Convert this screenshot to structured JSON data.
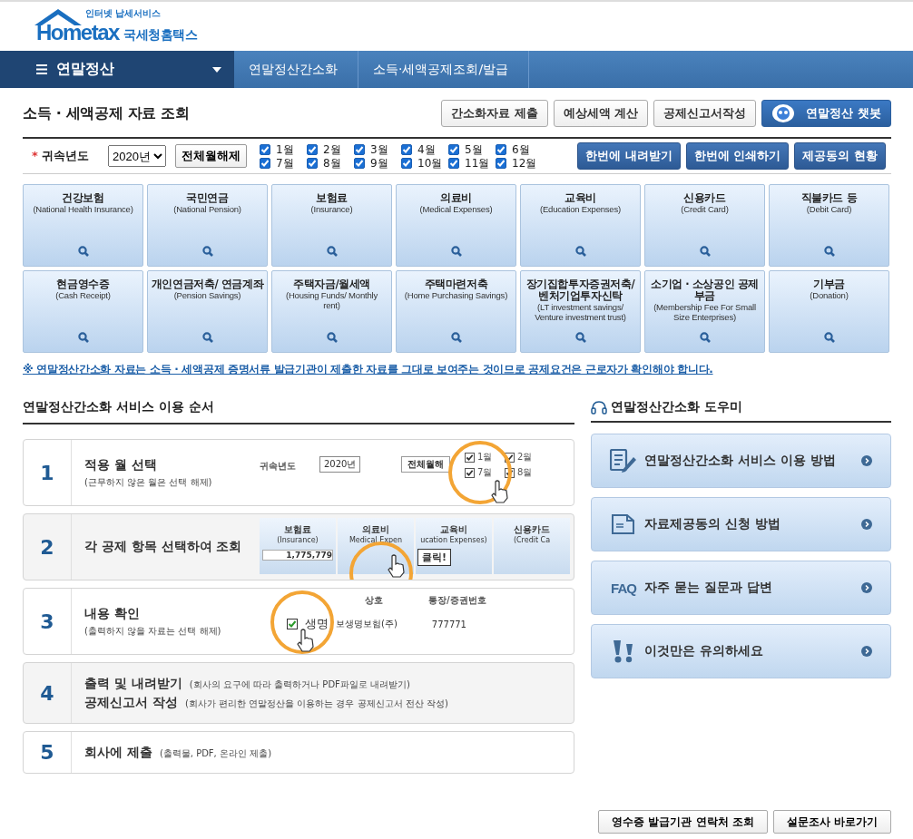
{
  "logo": {
    "tagline": "인터넷 납세서비스",
    "brand": "Hometax",
    "name": "국세청홈택스"
  },
  "nav": {
    "menu": "연말정산",
    "crumbs": [
      "연말정산간소화",
      "소득·세액공제조회/발급"
    ]
  },
  "page_title": "소득 · 세액공제 자료 조회",
  "top_buttons": [
    {
      "label": "간소화자료 제출",
      "kind": "plain"
    },
    {
      "label": "예상세액 계산",
      "kind": "plain"
    },
    {
      "label": "공제신고서작성",
      "kind": "plain"
    },
    {
      "label": "연말정산 챗봇",
      "kind": "chatbot"
    }
  ],
  "filter": {
    "required_mark": "*",
    "label": "귀속년도",
    "year": "2020년",
    "clear_button": "전체월해제",
    "months": [
      {
        "label": "1월",
        "checked": true
      },
      {
        "label": "2월",
        "checked": true
      },
      {
        "label": "3월",
        "checked": true
      },
      {
        "label": "4월",
        "checked": true
      },
      {
        "label": "5월",
        "checked": true
      },
      {
        "label": "6월",
        "checked": true
      },
      {
        "label": "7월",
        "checked": true
      },
      {
        "label": "8월",
        "checked": true
      },
      {
        "label": "9월",
        "checked": true
      },
      {
        "label": "10월",
        "checked": true
      },
      {
        "label": "11월",
        "checked": true
      },
      {
        "label": "12월",
        "checked": true
      }
    ],
    "actions": [
      "한번에 내려받기",
      "한번에 인쇄하기",
      "제공동의 현황"
    ]
  },
  "categories": [
    {
      "title": "건강보험",
      "sub": "(National Health Insurance)"
    },
    {
      "title": "국민연금",
      "sub": "(National Pension)"
    },
    {
      "title": "보험료",
      "sub": "(Insurance)"
    },
    {
      "title": "의료비",
      "sub": "(Medical Expenses)"
    },
    {
      "title": "교육비",
      "sub": "(Education Expenses)"
    },
    {
      "title": "신용카드",
      "sub": "(Credit Card)"
    },
    {
      "title": "직불카드 등",
      "sub": "(Debit Card)"
    },
    {
      "title": "현금영수증",
      "sub": "(Cash Receipt)"
    },
    {
      "title": "개인연금저축/ 연금계좌",
      "sub": "(Pension Savings)"
    },
    {
      "title": "주택자금/월세액",
      "sub": "(Housing Funds/ Monthly rent)"
    },
    {
      "title": "주택마련저축",
      "sub": "(Home Purchasing Savings)"
    },
    {
      "title": "장기집합투자증권저축/ 벤처기업투자신탁",
      "sub": "(LT investment savings/ Venture investment trust)"
    },
    {
      "title": "소기업 · 소상공인 공제부금",
      "sub": "(Membership Fee For Small Size Enterprises)"
    },
    {
      "title": "기부금",
      "sub": "(Donation)"
    }
  ],
  "notice": "※ 연말정산간소화 자료는 소득 · 세액공제 증명서류 발급기관이 제출한 자료를 그대로 보여주는 것이므로 공제요건은 근로자가 확인해야 합니다.",
  "steps_title": "연말정산간소화 서비스 이용 순서",
  "steps": [
    {
      "number": "1",
      "title": "적용 월 선택",
      "note": "(근무하지 않은 월은 선택 해제)",
      "kind": "months",
      "illustration": {
        "label": "귀속년도",
        "year": "2020년",
        "button": "전체월해",
        "months": [
          {
            "label": "1월",
            "checked": true
          },
          {
            "label": "2월",
            "checked": true
          },
          {
            "label": "7월",
            "checked": true
          },
          {
            "label": "8월",
            "checked": true
          }
        ]
      }
    },
    {
      "number": "2",
      "title": "각 공제 항목 선택하여 조회",
      "kind": "tiles",
      "illustration": {
        "tiles": [
          {
            "title": "보험료",
            "sub": "(Insurance)",
            "amount": "1,775,779"
          },
          {
            "title": "의료비",
            "sub": "Medical Expen"
          },
          {
            "title": "교육비",
            "sub": "ucation Expenses)"
          },
          {
            "title": "신용카드",
            "sub": "(Credit Ca"
          }
        ],
        "tooltip": "클릭!"
      }
    },
    {
      "number": "3",
      "title": "내용 확인",
      "note": "(출력하지 않을 자료는 선택 해제)",
      "kind": "table",
      "illustration": {
        "columns": [
          "상호",
          "통장/증권번호"
        ],
        "row": {
          "checked": true,
          "name": "생명",
          "company": "보생명보험(주)",
          "account": "777771"
        }
      }
    },
    {
      "number": "4",
      "kind": "lines",
      "lines": [
        {
          "title": "출력 및 내려받기",
          "note": "(회사의 요구에 따라 출력하거나 PDF파일로 내려받기)"
        },
        {
          "title": "공제신고서 작성",
          "note": "(회사가 편리한 연말정산을 이용하는 경우 공제신고서 전산 작성)"
        }
      ]
    },
    {
      "number": "5",
      "title": "회사에 제출",
      "inline_note": "(출력물, PDF, 온라인 제출)",
      "kind": "plain"
    }
  ],
  "helper_title": "연말정산간소화 도우미",
  "helpers": [
    {
      "label": "연말정산간소화 서비스 이용 방법",
      "kind": "guide"
    },
    {
      "label": "자료제공동의 신청 방법",
      "kind": "form"
    },
    {
      "label": "자주 묻는 질문과 답변",
      "kind": "faq",
      "badge": "FAQ"
    },
    {
      "label": "이것만은 유의하세요",
      "kind": "caution"
    }
  ],
  "bottom_buttons": [
    "영수증 발급기관 연락처 조회",
    "설문조사 바로가기"
  ]
}
